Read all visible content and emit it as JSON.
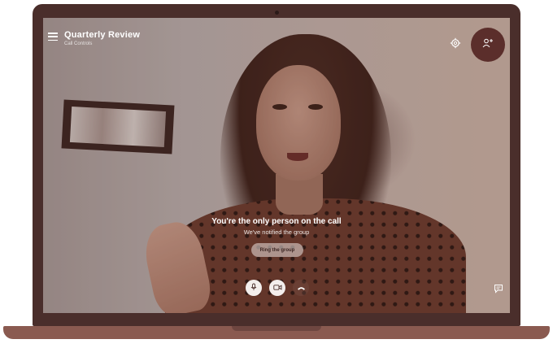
{
  "call": {
    "title": "Quarterly Review",
    "subtitle": "Call Controls"
  },
  "message": {
    "main": "You're the only person on the call",
    "sub": "We've notified the group"
  },
  "actions": {
    "ring_label": "Ring the group"
  },
  "controls": {
    "mic_icon": "microphone-icon",
    "video_icon": "video-camera-icon",
    "hangup_icon": "phone-hangup-icon",
    "chat_icon": "chat-bubble-icon",
    "settings_icon": "gear-icon",
    "add_people_icon": "add-person-icon",
    "menu_icon": "hamburger-menu-icon"
  },
  "colors": {
    "laptop_frame": "#4a2e2b",
    "laptop_base": "#8a5a50",
    "add_people_button": "#5b2e2b",
    "call_button_bg": "#f3eeec"
  }
}
